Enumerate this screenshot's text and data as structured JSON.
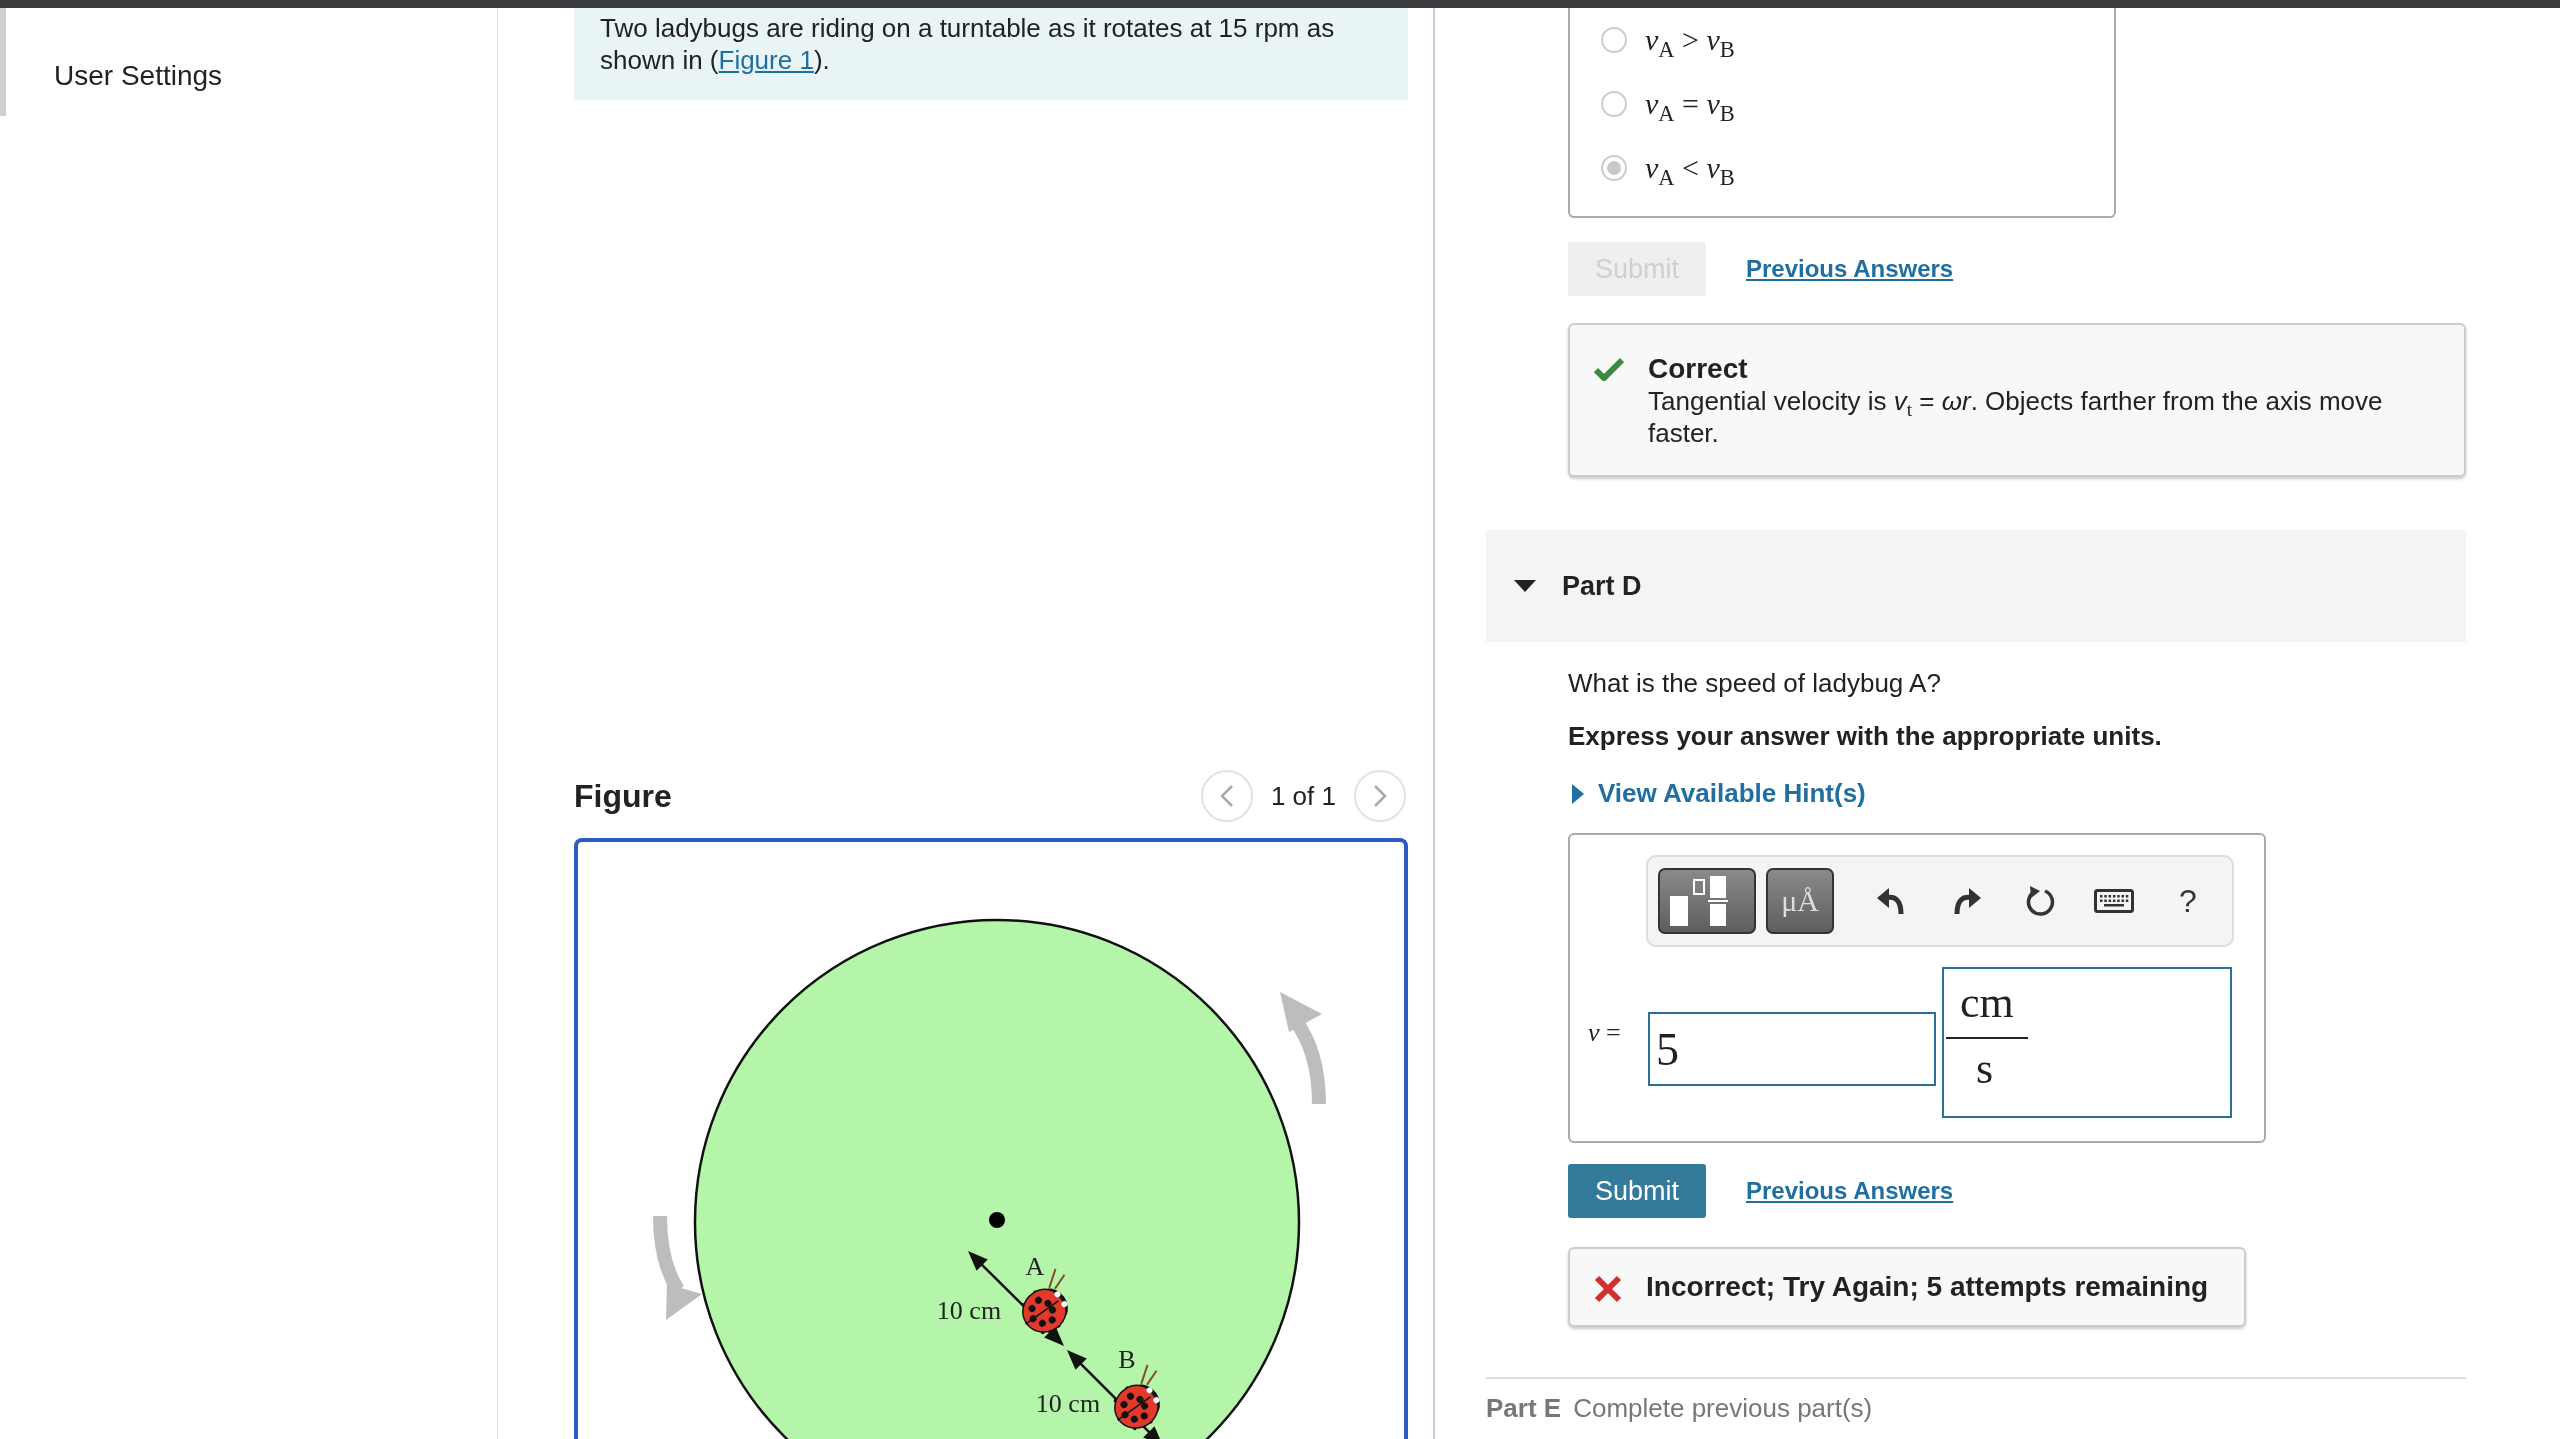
{
  "sidebar": {
    "items": [
      {
        "label": "User Settings"
      }
    ]
  },
  "problem": {
    "intro": {
      "text_before": "Two ladybugs are riding on a turntable as it rotates at 15 rpm as shown in (",
      "link": "Figure 1",
      "text_after": ")."
    },
    "figure": {
      "title": "Figure",
      "pager": "1 of 1",
      "distance_labels": [
        "10 cm",
        "10 cm"
      ],
      "bug_labels": [
        "A",
        "B"
      ]
    }
  },
  "part_c": {
    "options": [
      {
        "label": "*v*$_{A}$ > *v*$_{B}$",
        "selected": false
      },
      {
        "label": "*v*$_{A}$ = *v*$_{B}$",
        "selected": false
      },
      {
        "label": "*v*$_{A}$ < *v*$_{B}$",
        "selected": true
      }
    ],
    "submit": {
      "label": "Submit",
      "disabled": true
    },
    "previous_answers": "Previous Answers",
    "feedback": {
      "kind": "correct",
      "title": "Correct",
      "text": "Tangential velocity is *v*$_{t}$ = *ωr*. Objects farther from the axis move faster."
    }
  },
  "part_d": {
    "title": "Part D",
    "expanded": true,
    "question": "What is the speed of ladybug A?",
    "instruction": "Express your answer with the appropriate units.",
    "hints": {
      "label": "View Available Hint(s)",
      "expanded": false
    },
    "toolbar": {
      "units_label": "μÅ",
      "help_label": "?"
    },
    "variable": "*v* =",
    "value": "5",
    "units": {
      "numerator": "cm",
      "denominator": "s"
    },
    "submit": {
      "label": "Submit",
      "disabled": false
    },
    "previous_answers": "Previous Answers",
    "feedback": {
      "kind": "incorrect",
      "title": "Incorrect; Try Again; 5 attempts remaining"
    }
  },
  "part_e": {
    "title": "Part E",
    "status": "Complete previous part(s)"
  }
}
